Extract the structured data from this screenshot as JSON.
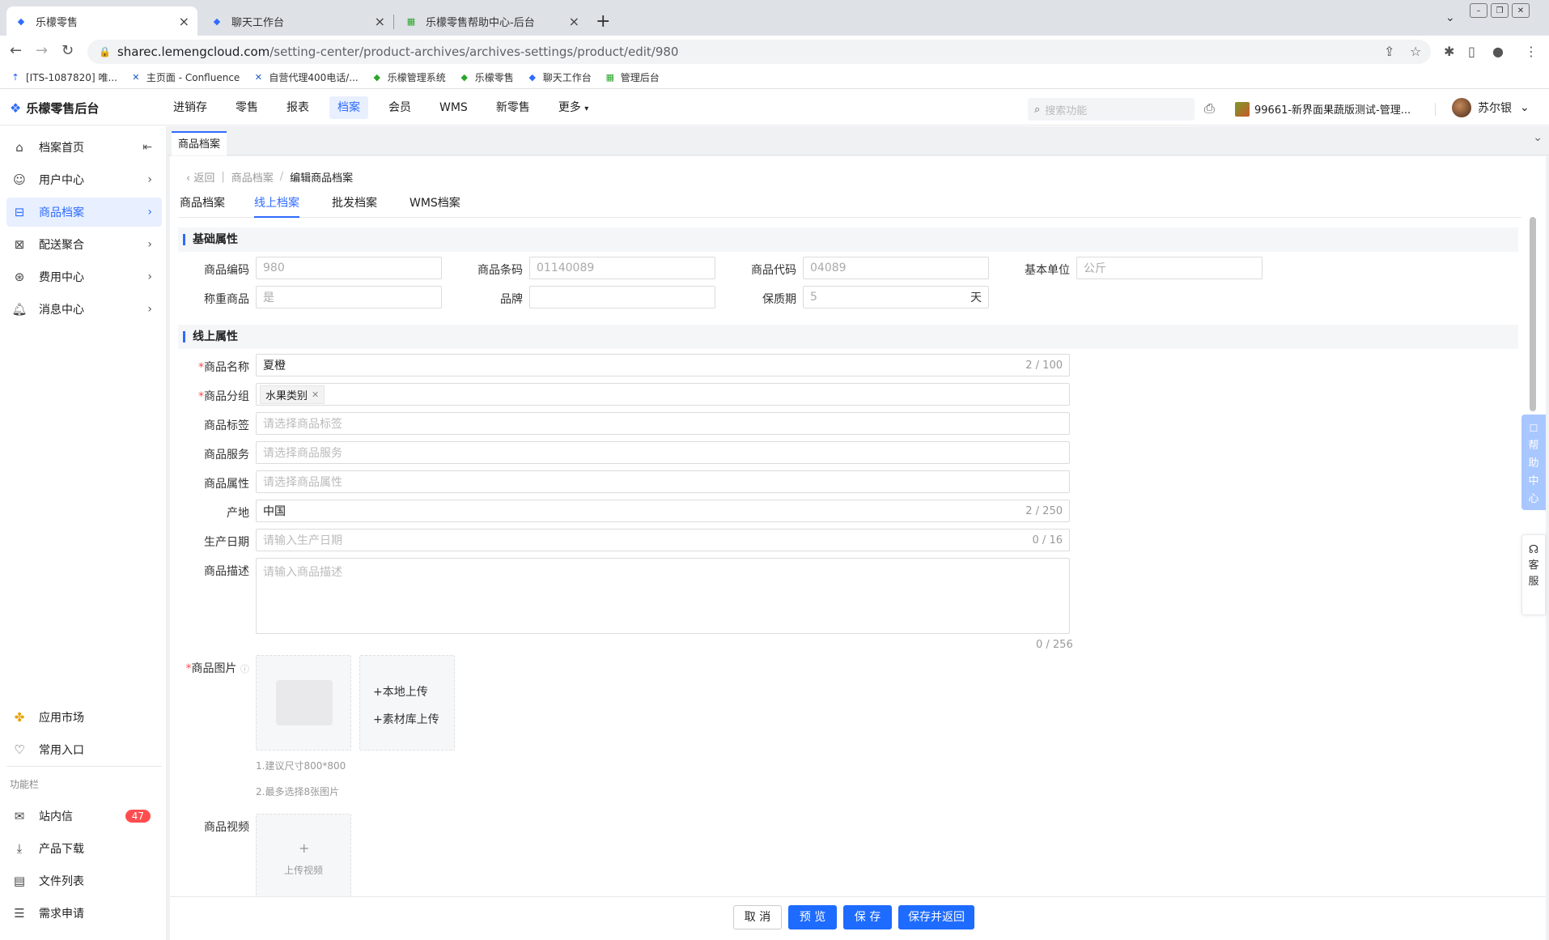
{
  "browser": {
    "tabs": [
      {
        "label": "乐檬零售",
        "active": true
      },
      {
        "label": "聊天工作台",
        "active": false
      },
      {
        "label": "乐檬零售帮助中心-后台",
        "active": false
      }
    ],
    "url_host": "sharec.lemengcloud.com",
    "url_path": "/setting-center/product-archives/archives-settings/product/edit/980",
    "bookmarks": [
      "[ITS-1087820] 唯...",
      "主页面 - Confluence",
      "自营代理400电话/...",
      "乐檬管理系统",
      "乐檬零售",
      "聊天工作台",
      "管理后台"
    ]
  },
  "app": {
    "logo": "乐檬零售后台",
    "nav": [
      "进销存",
      "零售",
      "报表",
      "档案",
      "会员",
      "WMS",
      "新零售",
      "更多"
    ],
    "nav_active": "档案",
    "search_placeholder": "搜索功能",
    "store": "99661-新界面果蔬版测试-管理...",
    "user": "苏尔银"
  },
  "sidebar": {
    "items": [
      "档案首页",
      "用户中心",
      "商品档案",
      "配送聚合",
      "费用中心",
      "消息中心"
    ],
    "bottom": [
      "应用市场",
      "常用入口"
    ],
    "section": "功能栏",
    "tools": [
      "站内信",
      "产品下载",
      "文件列表",
      "需求申请"
    ],
    "inbox_badge": "47"
  },
  "page": {
    "tab": "商品档案",
    "back": "返回",
    "crumb_parent": "商品档案",
    "crumb_current": "编辑商品档案",
    "subtabs": [
      "商品档案",
      "线上档案",
      "批发档案",
      "WMS档案"
    ],
    "subtab_active": "线上档案"
  },
  "basic": {
    "title": "基础属性",
    "fields": {
      "code_label": "商品编码",
      "code": "980",
      "barcode_label": "商品条码",
      "barcode": "01140089",
      "itemcode_label": "商品代码",
      "itemcode": "04089",
      "unit_label": "基本单位",
      "unit": "公斤",
      "weigh_label": "称重商品",
      "weigh": "是",
      "brand_label": "品牌",
      "brand": "",
      "shelf_label": "保质期",
      "shelf": "5",
      "shelf_unit": "天"
    }
  },
  "online": {
    "title": "线上属性",
    "name_label": "商品名称",
    "name": "夏橙",
    "name_count": "2 / 100",
    "group_label": "商品分组",
    "group_chip": "水果类别",
    "tag_label": "商品标签",
    "tag_ph": "请选择商品标签",
    "service_label": "商品服务",
    "service_ph": "请选择商品服务",
    "attr_label": "商品属性",
    "attr_ph": "请选择商品属性",
    "origin_label": "产地",
    "origin": "中国",
    "origin_count": "2 / 250",
    "date_label": "生产日期",
    "date_ph": "请输入生产日期",
    "date_count": "0 / 16",
    "desc_label": "商品描述",
    "desc_ph": "请输入商品描述",
    "desc_count": "0 / 256",
    "image_label": "商品图片",
    "local_upload": "本地上传",
    "lib_upload": "素材库上传",
    "hint1": "1.建议尺寸800*800",
    "hint2": "2.最多选择8张图片",
    "video_label": "商品视频",
    "video_upload": "上传视频"
  },
  "footer": {
    "cancel": "取 消",
    "preview": "预 览",
    "save": "保 存",
    "save_back": "保存并返回"
  },
  "floats": {
    "help": [
      "帮",
      "助",
      "中",
      "心"
    ],
    "cs": [
      "客",
      "服"
    ]
  }
}
